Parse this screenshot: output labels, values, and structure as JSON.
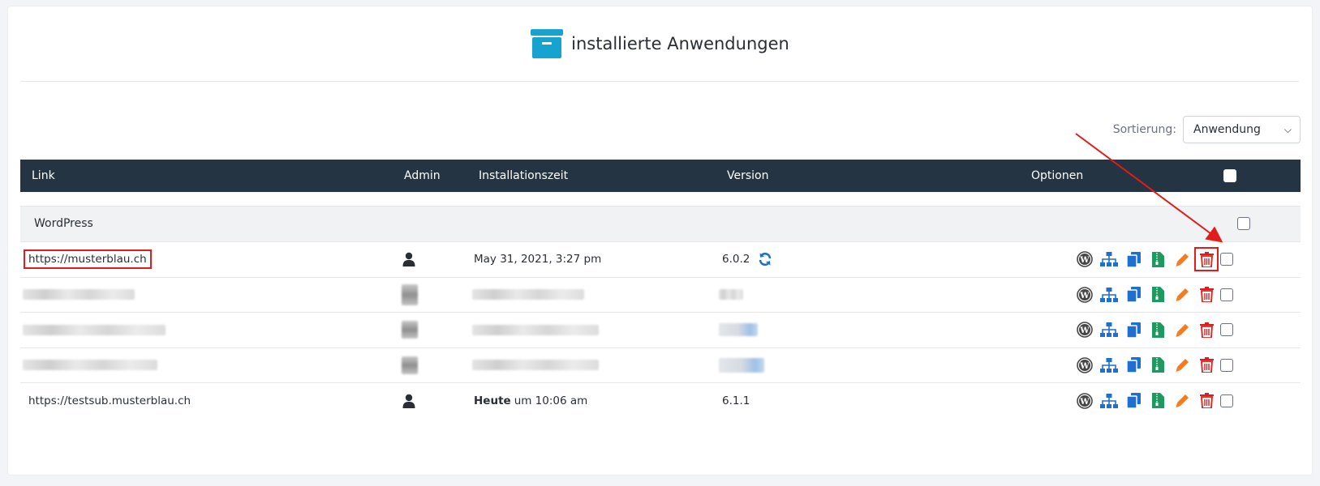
{
  "page": {
    "title": "installierte Anwendungen"
  },
  "sort": {
    "label": "Sortierung:",
    "selected": "Anwendung"
  },
  "table": {
    "columns": {
      "link": "Link",
      "admin": "Admin",
      "install_time": "Installationszeit",
      "version": "Version",
      "options": "Optionen"
    },
    "group": {
      "name": "WordPress"
    },
    "rows": [
      {
        "link": "https://musterblau.ch",
        "time_date": "May 31, 2021, 3:27 pm",
        "version": "6.0.2",
        "has_update": true
      },
      {
        "link": "",
        "time_date": "",
        "version": ""
      },
      {
        "link": "",
        "time_date": "",
        "version": ""
      },
      {
        "link": "",
        "time_date": "",
        "version": ""
      },
      {
        "link": "https://testsub.musterblau.ch",
        "time_bold": "Heute",
        "time_rest": "um 10:06 am",
        "version": "6.1.1",
        "has_update": false
      }
    ]
  },
  "icons": [
    "box-icon",
    "user-icon",
    "refresh-icon",
    "wordpress-icon",
    "sitemap-icon",
    "copy-icon",
    "zip-icon",
    "pencil-icon",
    "trash-icon"
  ],
  "colors": {
    "header_bg": "#253442",
    "accent": "#16a3cf",
    "blue": "#1f6fd1",
    "green": "#1e9960",
    "orange": "#f47b20",
    "red": "#e21b1b"
  }
}
